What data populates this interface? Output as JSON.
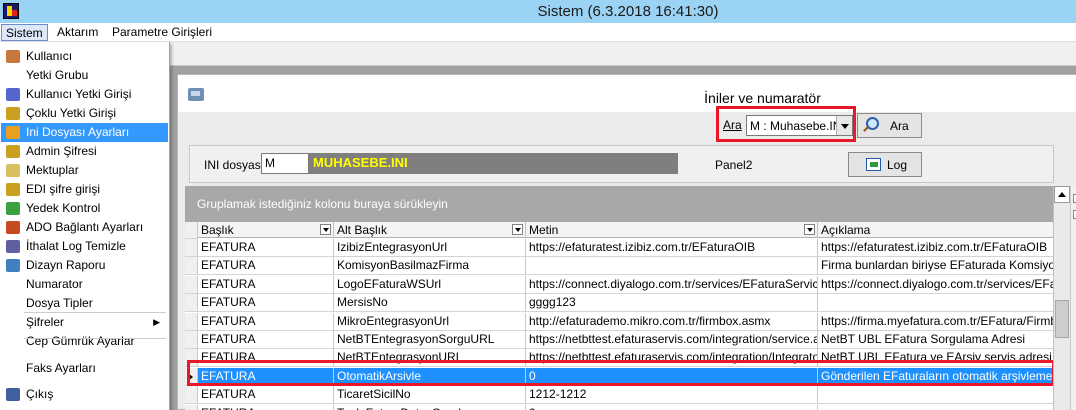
{
  "window": {
    "title": "Sistem (6.3.2018 16:41:30)"
  },
  "menubar": [
    {
      "label": "Sistem"
    },
    {
      "label": "Aktarım"
    },
    {
      "label": "Parametre Girişleri"
    }
  ],
  "sistem_menu": {
    "items": [
      {
        "label": "Kullanıcı",
        "icon": "user-icon",
        "color": "#c8783c"
      },
      {
        "label": "Yetki Grubu",
        "icon": "",
        "color": ""
      },
      {
        "label": "Kullanıcı Yetki Girişi",
        "icon": "user-permission-icon",
        "color": "#5566cc"
      },
      {
        "label": "Çoklu Yetki Girişi",
        "icon": "key-icon",
        "color": "#c9a020"
      },
      {
        "label": "Ini Dosyası Ayarları",
        "icon": "folder-settings-icon",
        "color": "#e8a020",
        "selected": true
      },
      {
        "label": "Admin Şifresi",
        "icon": "key-icon",
        "color": "#c9a020"
      },
      {
        "label": "Mektuplar",
        "icon": "envelope-icon",
        "color": "#d8c060"
      },
      {
        "label": "EDI şifre girişi",
        "icon": "key-icon",
        "color": "#c9a020"
      },
      {
        "label": "Yedek Kontrol",
        "icon": "backup-icon",
        "color": "#3aa040"
      },
      {
        "label": "ADO Bağlantı Ayarları",
        "icon": "connection-icon",
        "color": "#c84a20"
      },
      {
        "label": "İthalat Log Temizle",
        "icon": "log-clear-icon",
        "color": "#6060a0"
      },
      {
        "label": "Dizayn Raporu",
        "icon": "report-icon",
        "color": "#4080c0"
      },
      {
        "label": "Numarator",
        "icon": "",
        "color": ""
      },
      {
        "label": "Dosya Tipler",
        "icon": "",
        "color": ""
      },
      {
        "label": "Şifreler",
        "icon": "",
        "color": "",
        "submenu": true
      },
      {
        "label": "Cep Gümrük Ayarlar",
        "icon": "",
        "color": ""
      },
      {
        "label": "Faks Ayarları",
        "icon": "",
        "color": ""
      },
      {
        "label": "Çıkış",
        "icon": "exit-icon",
        "color": "#4060a0"
      }
    ]
  },
  "form": {
    "title": "İniler ve numaratör",
    "search": {
      "label": "Ara",
      "selected": "M : Muhasebe.INI",
      "button": "Ara"
    },
    "ini": {
      "label": "INI dosyası",
      "value": "M",
      "name": "MUHASEBE.INI"
    },
    "panel2": "Panel2",
    "log_button": "Log"
  },
  "grid": {
    "group_hint": "Gruplamak istediğiniz kolonu buraya sürükleyin",
    "columns": [
      "Başlık",
      "Alt Başlık",
      "Metin",
      "Açıklama"
    ],
    "rows": [
      [
        "EFATURA",
        "IzibizEntegrasyonUrl",
        "https://efaturatest.izibiz.com.tr/EFaturaOIB",
        "https://efaturatest.izibiz.com.tr/EFaturaOIB"
      ],
      [
        "EFATURA",
        "KomisyonBasilmazFirma",
        "",
        "Firma bunlardan biriyse EFaturada Komsiyon hesa"
      ],
      [
        "EFATURA",
        "LogoEFaturaWSUrl",
        "https://connect.diyalogo.com.tr/services/EFaturaService.svc",
        "https://connect.diyalogo.com.tr/services/EFatura"
      ],
      [
        "EFATURA",
        "MersisNo",
        "gggg123",
        ""
      ],
      [
        "EFATURA",
        "MikroEntegrasyonUrl",
        "http://efaturademo.mikro.com.tr/firmbox.asmx",
        "https://firma.myefatura.com.tr/EFatura/Firmbox/F"
      ],
      [
        "EFATURA",
        "NetBTEntegrasyonSorguURL",
        "https://netbttest.efaturaservis.com/integration/service.asmx",
        "NetBT UBL EFatura Sorgulama Adresi"
      ],
      [
        "EFATURA",
        "NetBTEntegrasyonURL",
        "https://netbttest.efaturaservis.com/integration/IntegratorService",
        "NetBT UBL EFatura ve EArsiv servis adresi"
      ],
      [
        "EFATURA",
        "OtomatikArsivle",
        "0",
        "Gönderilen EFaturaların otomatik arşivlemesi"
      ],
      [
        "EFATURA",
        "TicaretSicilNo",
        "1212-1212",
        ""
      ],
      [
        "EFATURA",
        "TopluFaturaDetayGrupla",
        "0",
        ""
      ]
    ],
    "selected_row": 7
  }
}
